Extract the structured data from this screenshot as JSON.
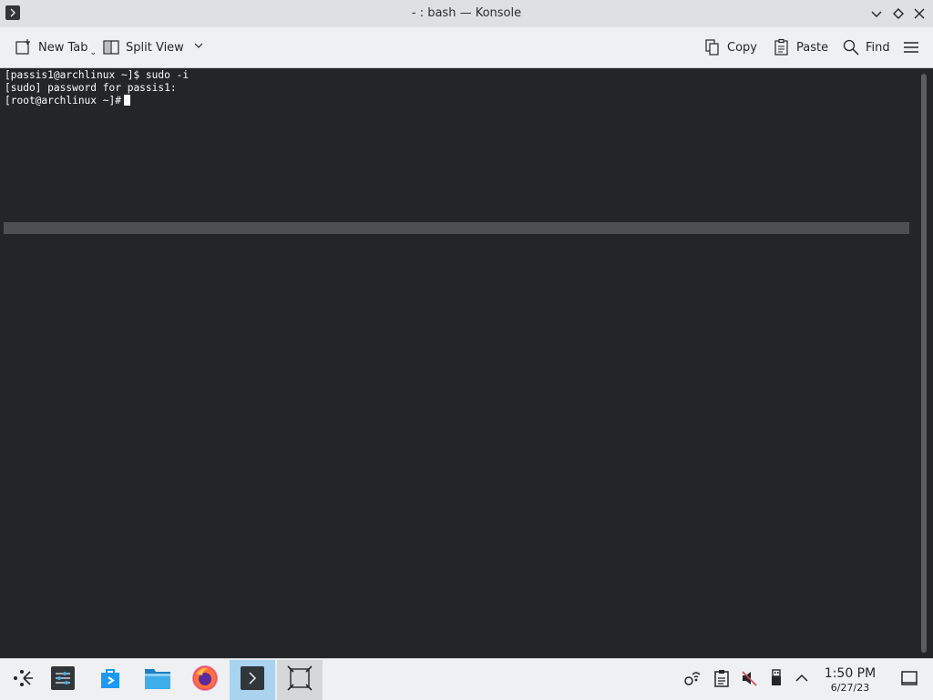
{
  "window": {
    "title": "- : bash — Konsole"
  },
  "toolbar": {
    "new_tab_label": "New Tab",
    "split_view_label": "Split View",
    "copy_label": "Copy",
    "paste_label": "Paste",
    "find_label": "Find"
  },
  "terminal": {
    "lines": [
      "[passis1@archlinux ~]$ sudo -i",
      "[sudo] password for passis1:",
      "[root@archlinux ~]#"
    ]
  },
  "taskbar": {
    "apps": [
      {
        "name": "app-launcher-icon"
      },
      {
        "name": "system-settings-icon"
      },
      {
        "name": "discover-icon"
      },
      {
        "name": "file-manager-icon"
      },
      {
        "name": "firefox-icon"
      },
      {
        "name": "konsole-icon"
      },
      {
        "name": "screen-edge-icon"
      }
    ],
    "tray": [
      "network-icon",
      "clipboard-icon",
      "volume-muted-icon",
      "usb-device-icon",
      "tray-expand-icon"
    ],
    "clock": {
      "time": "1:50 PM",
      "date": "6/27/23"
    }
  },
  "colors": {
    "terminal_bg": "#232627",
    "terminal_fg": "#fcfcfc",
    "titlebar_bg": "#dee0e2",
    "toolbar_bg": "#eff0f1",
    "active_task": "#a9d3ef"
  }
}
